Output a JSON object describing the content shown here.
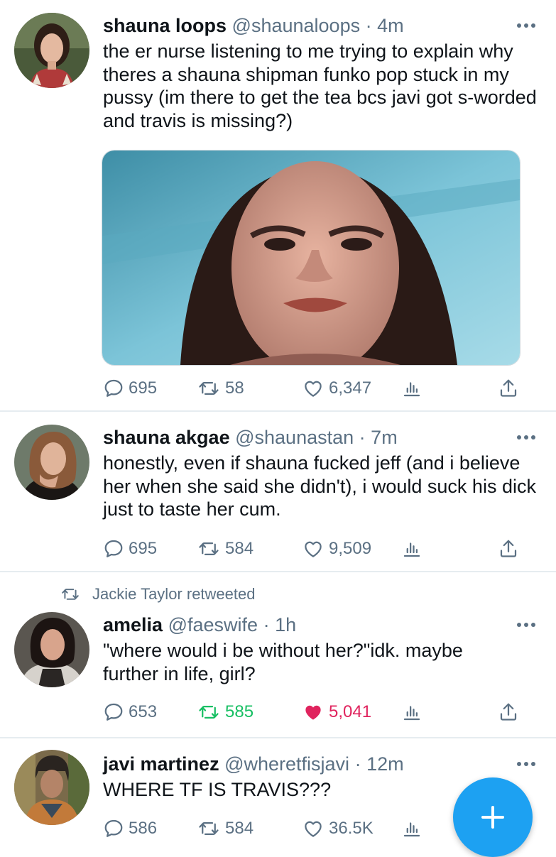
{
  "tweets": [
    {
      "name": "shauna loops",
      "handle": "@shaunaloops",
      "separator": "·",
      "time": "4m",
      "text": "the er nurse listening to me trying to explain why theres a shauna shipman funko pop stuck in my pussy (im there to get the tea bcs javi got s-worded and travis is missing?)",
      "replies": "695",
      "retweets": "58",
      "likes": "6,347"
    },
    {
      "name": "shauna akgae",
      "handle": "@shaunastan",
      "separator": "·",
      "time": "7m",
      "text": "honestly, even if shauna fucked jeff (and i believe her when she said she didn't), i would suck his dick just to taste her cum.",
      "replies": "695",
      "retweets": "584",
      "likes": "9,509"
    },
    {
      "retweeted_by": "Jackie Taylor retweeted",
      "name": "amelia",
      "handle": "@faeswife",
      "separator": "·",
      "time": "1h",
      "text": "\"where would i be without her?\"idk. maybe further in life, girl?",
      "replies": "653",
      "retweets": "585",
      "likes": "5,041",
      "retweet_color": "#17bf63",
      "like_color": "#e0245e"
    },
    {
      "name": "javi martinez",
      "handle": "@wheretfisjavi",
      "separator": "·",
      "time": "12m",
      "text": "WHERE TF IS TRAVIS???",
      "replies": "586",
      "retweets": "584",
      "likes": "36.5K"
    }
  ],
  "icons": {
    "reply": "speech-bubble-icon",
    "retweet": "retweet-arrows-icon",
    "like": "heart-icon",
    "analytics": "bar-chart-icon",
    "share": "share-upload-icon",
    "more": "three-dots-icon",
    "compose": "plus-icon"
  },
  "colors": {
    "accent": "#1da1f2",
    "muted": "#5b7083",
    "text": "#0f1419"
  }
}
